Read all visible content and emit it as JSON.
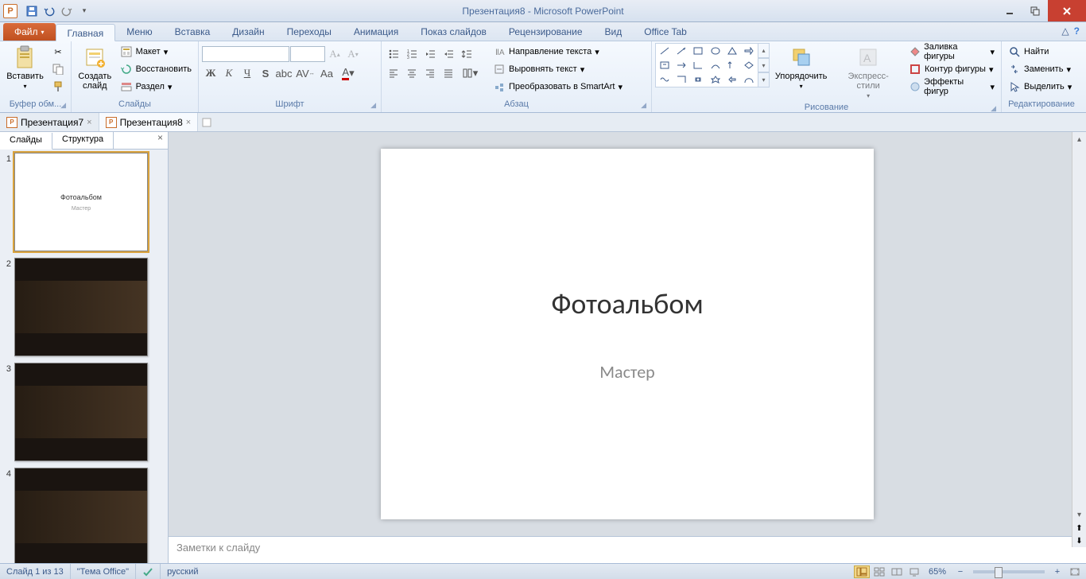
{
  "titlebar": {
    "title": "Презентация8 - Microsoft PowerPoint"
  },
  "ribbon_tabs": {
    "file": "Файл",
    "items": [
      "Главная",
      "Меню",
      "Вставка",
      "Дизайн",
      "Переходы",
      "Анимация",
      "Показ слайдов",
      "Рецензирование",
      "Вид",
      "Office Tab"
    ],
    "active_index": 0
  },
  "groups": {
    "clipboard": {
      "paste": "Вставить",
      "label": "Буфер обм..."
    },
    "slides": {
      "new_slide": "Создать\nслайд",
      "layout": "Макет",
      "restore": "Восстановить",
      "section": "Раздел",
      "label": "Слайды"
    },
    "font": {
      "label": "Шрифт"
    },
    "paragraph": {
      "text_direction": "Направление текста",
      "align_text": "Выровнять текст",
      "to_smartart": "Преобразовать в SmartArt",
      "label": "Абзац"
    },
    "drawing": {
      "arrange": "Упорядочить",
      "quick_styles": "Экспресс-стили",
      "fill": "Заливка фигуры",
      "outline": "Контур фигуры",
      "effects": "Эффекты фигур",
      "label": "Рисование"
    },
    "editing": {
      "find": "Найти",
      "replace": "Заменить",
      "select": "Выделить",
      "label": "Редактирование"
    }
  },
  "doc_tabs": {
    "items": [
      {
        "name": "Презентация7",
        "active": false
      },
      {
        "name": "Презентация8",
        "active": true
      }
    ]
  },
  "panel_tabs": {
    "slides": "Слайды",
    "outline": "Структура"
  },
  "thumbnails": [
    {
      "num": 1,
      "type": "title",
      "title": "Фотоальбом",
      "sub": "Мастер",
      "selected": true
    },
    {
      "num": 2,
      "type": "dark"
    },
    {
      "num": 3,
      "type": "dark"
    },
    {
      "num": 4,
      "type": "dark"
    }
  ],
  "slide": {
    "title": "Фотоальбом",
    "subtitle": "Мастер"
  },
  "notes": {
    "placeholder": "Заметки к слайду"
  },
  "status": {
    "slide_info": "Слайд 1 из 13",
    "theme": "\"Тема Office\"",
    "lang": "русский",
    "zoom": "65%"
  }
}
